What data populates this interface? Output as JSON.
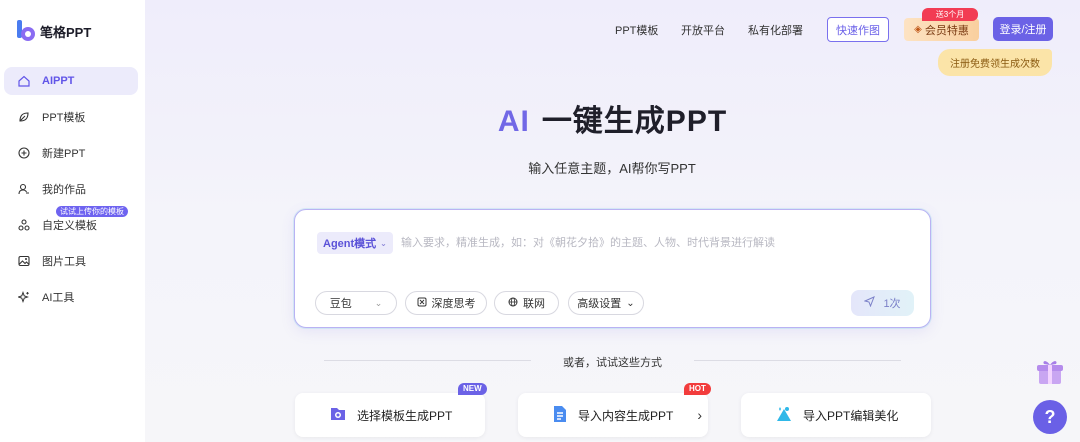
{
  "brand": {
    "name": "笔格PPT",
    "accent": "#6b62e6"
  },
  "sidebar": {
    "items": [
      {
        "label": "AIPPT",
        "icon": "home-icon",
        "active": true
      },
      {
        "label": "PPT模板",
        "icon": "leaf-icon"
      },
      {
        "label": "新建PPT",
        "icon": "plus-circle-icon"
      },
      {
        "label": "我的作品",
        "icon": "user-doc-icon"
      },
      {
        "label": "自定义模板",
        "icon": "shapes-icon"
      },
      {
        "label": "图片工具",
        "icon": "image-icon"
      },
      {
        "label": "AI工具",
        "icon": "sparkle-icon"
      }
    ],
    "tip": "试试上传你的模板"
  },
  "header": {
    "nav": [
      "PPT模板",
      "开放平台",
      "私有化部署"
    ],
    "quick_button": "快速作图",
    "member_button": "会员特惠",
    "member_badge": "送3个月",
    "login_button": "登录/注册",
    "login_tip": "注册免费领生成次数"
  },
  "hero": {
    "title_ai": "AI",
    "title_rest": "一键生成PPT",
    "subtitle": "输入任意主题，AI帮你写PPT"
  },
  "composer": {
    "mode": "Agent模式",
    "placeholder": "输入要求，精准生成，如：对《朝花夕拾》的主题、人物、时代背景进行解读",
    "model": "豆包",
    "deep_think": "深度思考",
    "web": "联网",
    "advanced": "高级设置",
    "send_count": "1次"
  },
  "alternatives": {
    "label": "或者，试试这些方式",
    "options": [
      {
        "label": "选择模板生成PPT",
        "tag": "NEW",
        "tag_color": "#6b62e6"
      },
      {
        "label": "导入内容生成PPT",
        "tag": "HOT",
        "tag_color": "#f23c3c"
      },
      {
        "label": "导入PPT编辑美化",
        "tag": ""
      }
    ]
  },
  "help": "?"
}
